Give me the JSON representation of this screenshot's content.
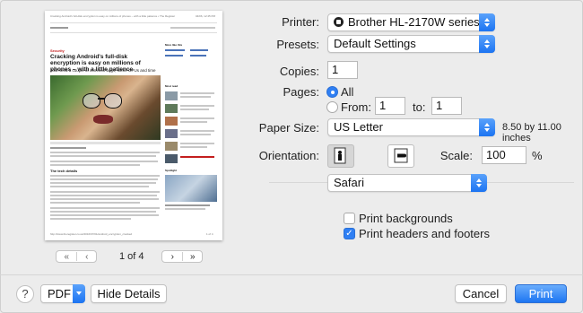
{
  "preview": {
    "browser_line": "Cracking Android's full-disk encryption is easy on millions of phones – with a little patience • The Register",
    "browser_date": "04/06, 12:45 PM",
    "section": "Security",
    "headline": "Cracking Android's full-disk encryption is easy on millions of phones – with a little patience",
    "subhead": "Just need a couple of common bugs, some GPUs and time",
    "sidebar_title": "More like this",
    "most_read": "Most read",
    "spotlight": "Spotlight",
    "tech_details": "The tech details",
    "footer_line": "http://www.theregister.co.uk/2016/07/01/android_encryption_cracked",
    "page_label": "1 of 4"
  },
  "nav": {
    "first_label": "«",
    "prev_label": "‹",
    "next_label": "›",
    "last_label": "»",
    "page_indicator": "1 of 4"
  },
  "printer": {
    "label": "Printer:",
    "value": "Brother HL-2170W series",
    "icon": "printer-icon"
  },
  "presets": {
    "label": "Presets:",
    "value": "Default Settings"
  },
  "copies": {
    "label": "Copies:",
    "value": "1"
  },
  "pages": {
    "label": "Pages:",
    "all_label": "All",
    "from_label": "From:",
    "from_value": "1",
    "to_label": "to:",
    "to_value": "1",
    "selected": "All"
  },
  "paper_size": {
    "label": "Paper Size:",
    "value": "US Letter",
    "dimensions": "8.50 by 11.00 inches"
  },
  "orientation": {
    "label": "Orientation:",
    "selected": "portrait"
  },
  "scale": {
    "label": "Scale:",
    "value": "100",
    "unit": "%"
  },
  "app_menu": {
    "value": "Safari"
  },
  "options": {
    "print_backgrounds": {
      "label": "Print backgrounds",
      "checked": false
    },
    "print_headers_footers": {
      "label": "Print headers and footers",
      "checked": true
    }
  },
  "footer": {
    "help_label": "?",
    "pdf_label": "PDF",
    "hide_details_label": "Hide Details",
    "cancel_label": "Cancel",
    "print_label": "Print"
  },
  "colors": {
    "accent": "#1d76f2",
    "background": "#ececec"
  }
}
